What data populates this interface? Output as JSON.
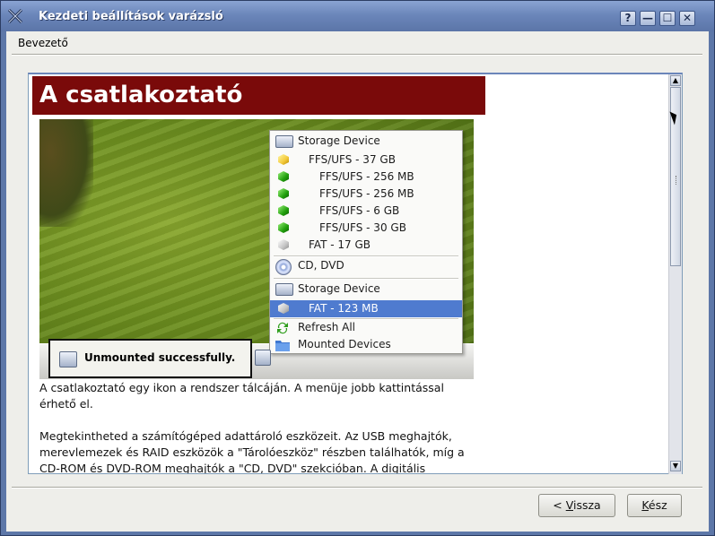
{
  "window": {
    "title": "Kezdeti beállítások varázsló",
    "buttons": {
      "help": "?",
      "minimize": "—",
      "maximize": "☐",
      "close": "✕"
    }
  },
  "tab": {
    "label": "Bevezető"
  },
  "page": {
    "heading": "A csatlakoztató",
    "menu_items": [
      {
        "label": "Storage Device",
        "icon": "drive-icon"
      },
      {
        "label": "FFS/UFS - 37 GB",
        "icon": "yellow-hex-icon"
      },
      {
        "label": "FFS/UFS - 256 MB",
        "icon": "green-hex-icon"
      },
      {
        "label": "FFS/UFS - 256 MB",
        "icon": "green-hex-icon"
      },
      {
        "label": "FFS/UFS - 6 GB",
        "icon": "green-hex-icon"
      },
      {
        "label": "FFS/UFS - 30 GB",
        "icon": "green-hex-icon"
      },
      {
        "label": "FAT - 17 GB",
        "icon": "grey-hex-icon"
      },
      {
        "label": "CD, DVD",
        "icon": "cd-icon"
      },
      {
        "label": "Storage Device",
        "icon": "drive-icon"
      },
      {
        "label": "FAT - 123 MB",
        "icon": "grey-hex-icon"
      },
      {
        "label": "Refresh All",
        "icon": "refresh-icon"
      },
      {
        "label": "Mounted Devices",
        "icon": "folder-icon"
      }
    ],
    "toast": "Unmounted successfully.",
    "paragraph1_line1": "A csatlakoztató egy ikon a rendszer tálcáján. A menüje jobb kattintással",
    "paragraph1_line2": "érhető el.",
    "paragraph2_line1": "Megtekintheted a számítógéped adattároló eszközeit. Az USB meghajtók,",
    "paragraph2_line2": "merevlemezek és RAID eszközök a \"Tárolóeszköz\" részben találhatók, míg a",
    "paragraph2_line3": "CD-ROM és DVD-ROM meghajtók a \"CD, DVD\" szekcióban. A digitális"
  },
  "footer": {
    "back_prefix": "< ",
    "back_mnemonic": "V",
    "back_rest": "issza",
    "done_mnemonic": "K",
    "done_rest": "ész"
  }
}
